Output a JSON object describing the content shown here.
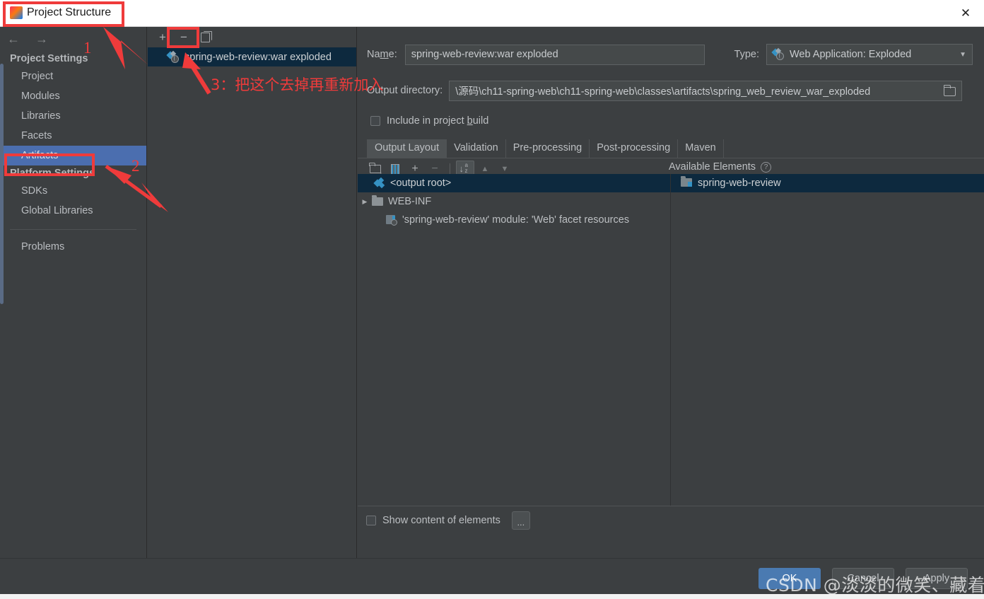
{
  "window": {
    "title": "Project Structure",
    "close_label": "✕",
    "app_icon": "intellij-idea-icon"
  },
  "sidebar": {
    "back_arrow": "←",
    "forward_arrow": "→",
    "groups": [
      {
        "label": "Project Settings",
        "items": [
          {
            "label": "Project",
            "selected": false
          },
          {
            "label": "Modules",
            "selected": false
          },
          {
            "label": "Libraries",
            "selected": false
          },
          {
            "label": "Facets",
            "selected": false
          },
          {
            "label": "Artifacts",
            "selected": true
          }
        ]
      },
      {
        "label": "Platform Settings",
        "items": [
          {
            "label": "SDKs",
            "selected": false
          },
          {
            "label": "Global Libraries",
            "selected": false
          }
        ]
      }
    ],
    "problems_label": "Problems",
    "help_label": "?"
  },
  "artifacts_panel": {
    "toolbar": {
      "add_label": "+",
      "remove_label": "−",
      "copy_label": "copy"
    },
    "items": [
      {
        "label": "spring-web-review:war exploded",
        "selected": true
      }
    ]
  },
  "detail": {
    "name_label_pre": "Na",
    "name_label_mid": "m",
    "name_label_post": "e:",
    "name_value": "spring-web-review:war exploded",
    "type_label": "Type:",
    "type_value": "Web Application: Exploded",
    "type_caret": "▼",
    "output_dir_label": "Output directory:",
    "output_dir_value": "\\源码\\ch11-spring-web\\ch11-spring-web\\classes\\artifacts\\spring_web_review_war_exploded",
    "include_in_build_label": "Include in project build",
    "include_in_build_checked": false,
    "tabs": [
      {
        "label": "Output Layout",
        "active": true
      },
      {
        "label": "Validation",
        "active": false
      },
      {
        "label": "Pre-processing",
        "active": false
      },
      {
        "label": "Post-processing",
        "active": false
      },
      {
        "label": "Maven",
        "active": false
      }
    ],
    "layout_toolbar": {
      "create_directory": "folder-add",
      "create_archive": "archive",
      "add_copy_of": "+",
      "remove": "−",
      "sort": "sort-az",
      "move_up": "▲",
      "move_down": "▼"
    },
    "available_elements_label": "Available Elements",
    "available_help": "?",
    "output_tree": [
      {
        "label": "<output root>",
        "icon": "output-root-icon",
        "selected": true,
        "twisty": "",
        "indent": 0
      },
      {
        "label": "WEB-INF",
        "icon": "folder-icon",
        "selected": false,
        "twisty": "▶",
        "indent": 1
      },
      {
        "label": "'spring-web-review' module: 'Web' facet resources",
        "icon": "module-web-icon",
        "selected": false,
        "twisty": "",
        "indent": 1
      }
    ],
    "available_tree": [
      {
        "label": "spring-web-review",
        "icon": "module-icon",
        "selected": true
      }
    ],
    "show_content_label": "Show content of elements",
    "show_content_checked": false,
    "dots_label": "..."
  },
  "footer": {
    "ok_label": "OK",
    "cancel_label": "Cancel",
    "apply_label": "Apply"
  },
  "annotations": {
    "num_1": "1",
    "num_2": "2",
    "step_3_text": "3：把这个去掉再重新加入",
    "color": "#ef3b3b",
    "watermark": "CSDN @淡淡的微笑、藏着伤！"
  }
}
